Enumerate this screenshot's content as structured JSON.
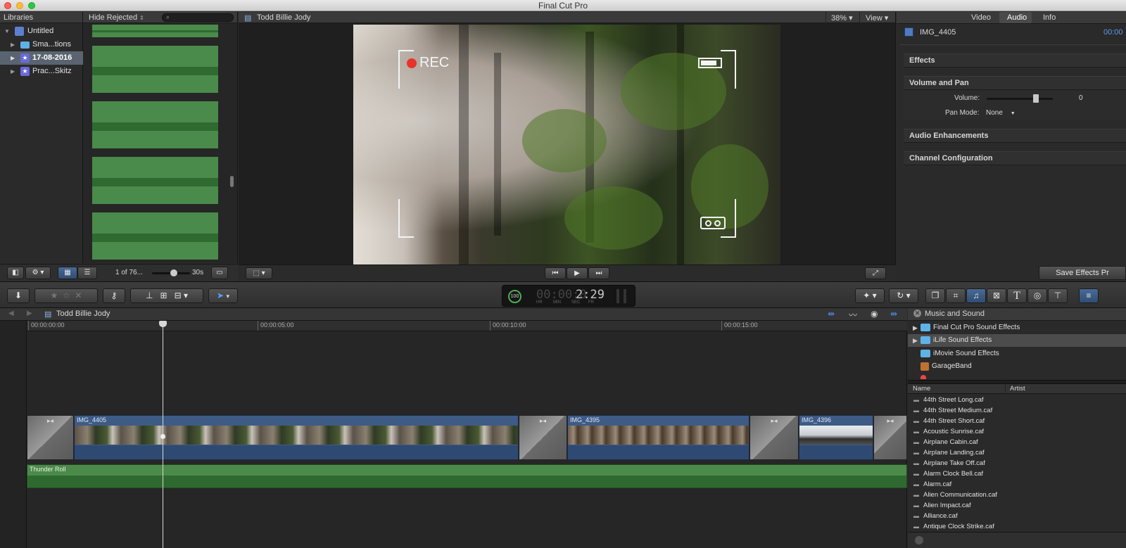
{
  "app": {
    "title": "Final Cut Pro"
  },
  "libraries": {
    "header": "Libraries",
    "items": [
      {
        "label": "Untitled",
        "kind": "library",
        "selected": false
      },
      {
        "label": "Sma...tions",
        "kind": "folder",
        "selected": false
      },
      {
        "label": "17-08-2016",
        "kind": "event",
        "selected": true
      },
      {
        "label": "Prac...Skitz",
        "kind": "event",
        "selected": false
      }
    ]
  },
  "browser": {
    "filter": "Hide Rejected",
    "search_placeholder": "",
    "count": "1 of 76...",
    "duration": "30s"
  },
  "viewer": {
    "title": "Todd Billie Jody",
    "zoom": "38%",
    "view_menu": "View",
    "overlay_text": "REC"
  },
  "inspector": {
    "tabs": [
      "Video",
      "Audio",
      "Info"
    ],
    "active_tab": "Audio",
    "clip_name": "IMG_4405",
    "timecode": "00:00",
    "sections": {
      "effects": "Effects",
      "volume_pan": "Volume and Pan",
      "volume_label": "Volume:",
      "volume_value": "0",
      "pan_mode_label": "Pan Mode:",
      "pan_mode_value": "None",
      "audio_enh": "Audio Enhancements",
      "channel_config": "Channel Configuration"
    },
    "save_button": "Save Effects Pr"
  },
  "toolbar": {
    "timecode_percent": "100",
    "timecode": "2:29",
    "timecode_prefix": "00:00:0",
    "units": [
      "HR",
      "MIN",
      "SEC",
      "FR"
    ]
  },
  "timeline": {
    "project_name": "Todd Billie Jody",
    "ruler": [
      "00:00:00:00",
      "00:00:05:00",
      "00:00:10:00",
      "00:00:15:00"
    ],
    "clips": [
      "IMG_4405",
      "IMG_4395",
      "IMG_4396"
    ],
    "audio_clip": "Thunder Roll"
  },
  "music": {
    "title": "Music and Sound",
    "folders": [
      {
        "label": "Final Cut Pro Sound Effects",
        "selected": false,
        "expandable": true
      },
      {
        "label": "iLife Sound Effects",
        "selected": true,
        "expandable": true
      },
      {
        "label": "iMovie Sound Effects",
        "selected": false,
        "expandable": false
      },
      {
        "label": "GarageBand",
        "selected": false,
        "expandable": false
      }
    ],
    "columns": [
      "Name",
      "Artist"
    ],
    "files": [
      "44th Street Long.caf",
      "44th Street Medium.caf",
      "44th Street Short.caf",
      "Acoustic Sunrise.caf",
      "Airplane Cabin.caf",
      "Airplane Landing.caf",
      "Airplane Take Off.caf",
      "Alarm Clock Bell.caf",
      "Alarm.caf",
      "Alien Communication.caf",
      "Alien Impact.caf",
      "Alliance.caf",
      "Antique Clock Strike.caf"
    ]
  }
}
